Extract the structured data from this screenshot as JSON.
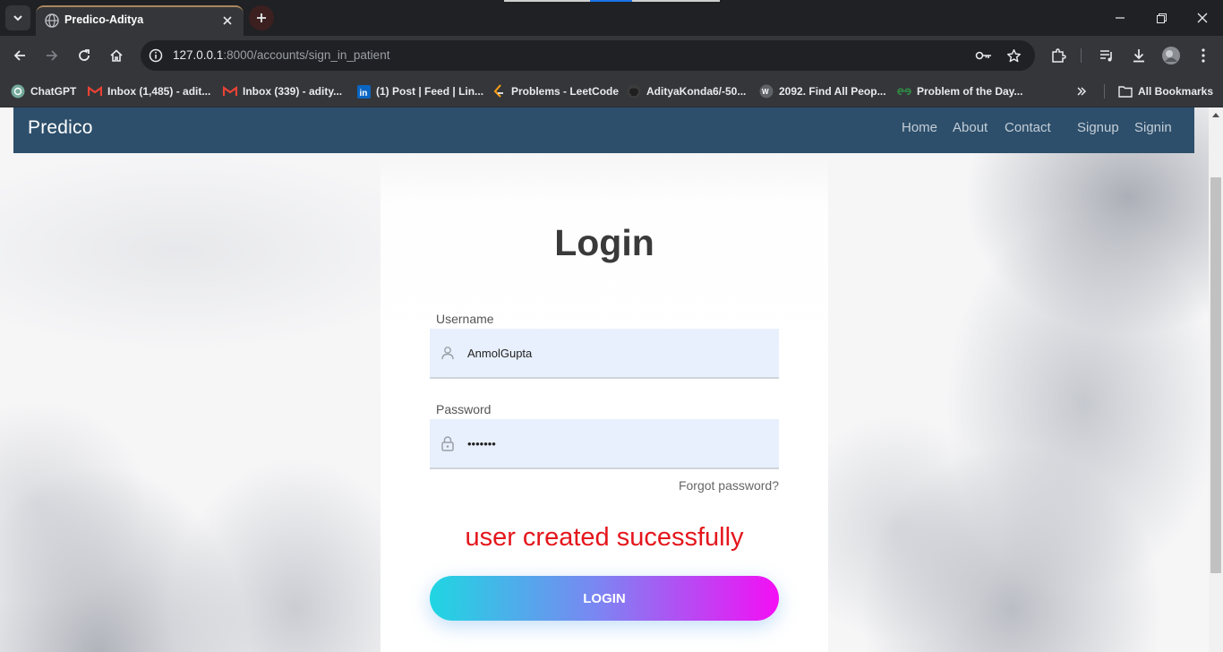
{
  "browser": {
    "tab_title": "Predico-Aditya",
    "url_host": "127.0.0.1",
    "url_rest": ":8000/accounts/sign_in_patient"
  },
  "bookmarks": [
    {
      "label": "ChatGPT",
      "icon": "chatgpt-icon"
    },
    {
      "label": "Inbox (1,485) - adit...",
      "icon": "gmail-icon"
    },
    {
      "label": "Inbox (339) - adity...",
      "icon": "gmail-icon"
    },
    {
      "label": "(1) Post | Feed | Lin...",
      "icon": "linkedin-icon"
    },
    {
      "label": "Problems - LeetCode",
      "icon": "leetcode-icon"
    },
    {
      "label": "AdityaKonda6/-50...",
      "icon": "github-icon"
    },
    {
      "label": "2092. Find All Peop...",
      "icon": "site-icon"
    },
    {
      "label": "Problem of the Day...",
      "icon": "gfg-icon"
    }
  ],
  "all_bookmarks_label": "All Bookmarks",
  "site": {
    "brand": "Predico",
    "nav": [
      "Home",
      "About",
      "Contact",
      "Signup",
      "Signin"
    ]
  },
  "login": {
    "heading": "Login",
    "username_label": "Username",
    "username_value": "AnmolGupta",
    "password_label": "Password",
    "password_value": "•••••••",
    "forgot": "Forgot password?",
    "message": "user created sucessfully",
    "button": "LOGIN"
  },
  "colors": {
    "navbar": "#2d4f6b",
    "message": "#e4161c",
    "button_gradient_start": "#1fd6e2",
    "button_gradient_end": "#f40ef4"
  }
}
